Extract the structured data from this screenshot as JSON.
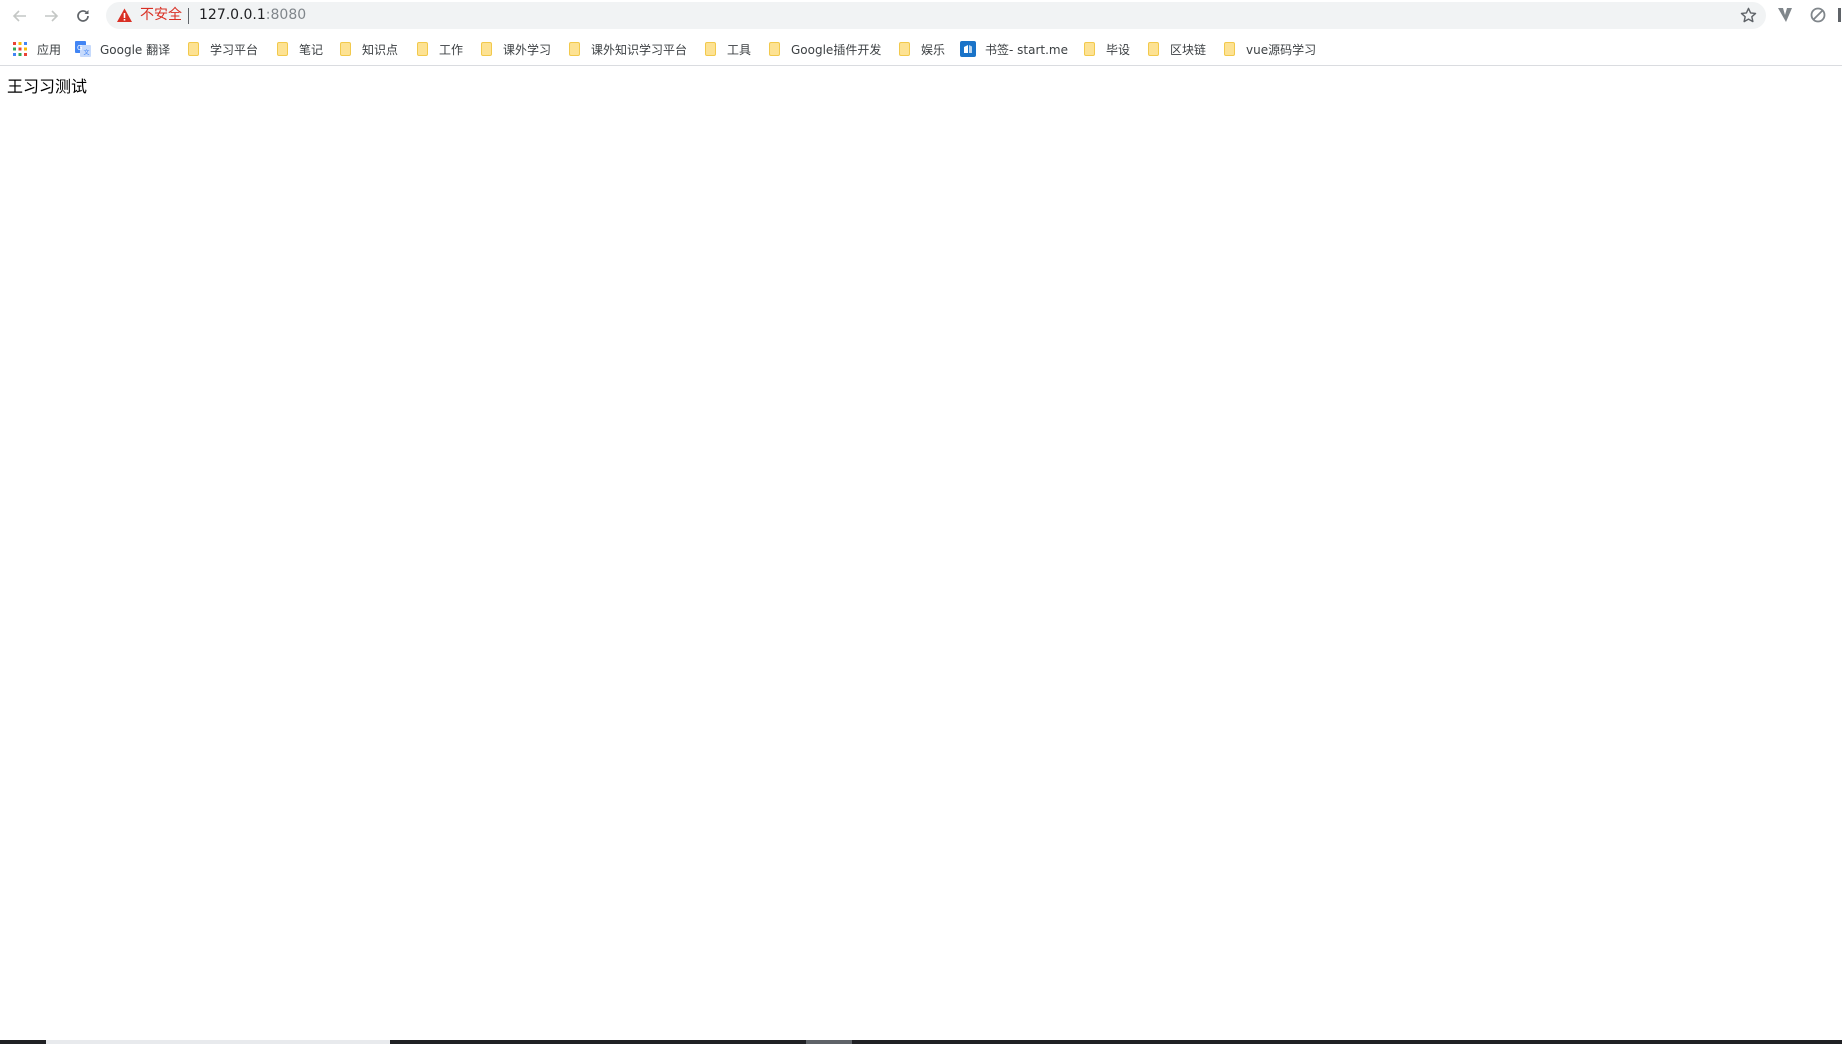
{
  "browser": {
    "security_label": "不安全",
    "url_host": "127.0.0.1",
    "url_port": ":8080",
    "icons": {
      "back": "back-arrow-icon",
      "forward": "forward-arrow-icon",
      "reload": "reload-icon",
      "warning": "warning-triangle-icon",
      "star": "star-icon",
      "ext_v": "extension-v-icon",
      "ext_block": "block-icon"
    },
    "colors": {
      "warning": "#d93025",
      "omnibox_bg": "#f1f3f4",
      "folder": "#fde293"
    }
  },
  "bookmarks": [
    {
      "label": "应用",
      "icon": "apps-grid-icon"
    },
    {
      "label": "Google 翻译",
      "icon": "google-translate-icon"
    },
    {
      "label": "学习平台",
      "icon": "folder-icon"
    },
    {
      "label": "笔记",
      "icon": "folder-icon"
    },
    {
      "label": "知识点",
      "icon": "folder-icon"
    },
    {
      "label": "工作",
      "icon": "folder-icon"
    },
    {
      "label": "课外学习",
      "icon": "folder-icon"
    },
    {
      "label": "课外知识学习平台",
      "icon": "folder-icon"
    },
    {
      "label": "工具",
      "icon": "folder-icon"
    },
    {
      "label": "Google插件开发",
      "icon": "folder-icon"
    },
    {
      "label": "娱乐",
      "icon": "folder-icon"
    },
    {
      "label": "书签- start.me",
      "icon": "startme-icon"
    },
    {
      "label": "毕设",
      "icon": "folder-icon"
    },
    {
      "label": "区块链",
      "icon": "folder-icon"
    },
    {
      "label": "vue源码学习",
      "icon": "folder-icon"
    }
  ],
  "page": {
    "text": "王习习测试"
  }
}
